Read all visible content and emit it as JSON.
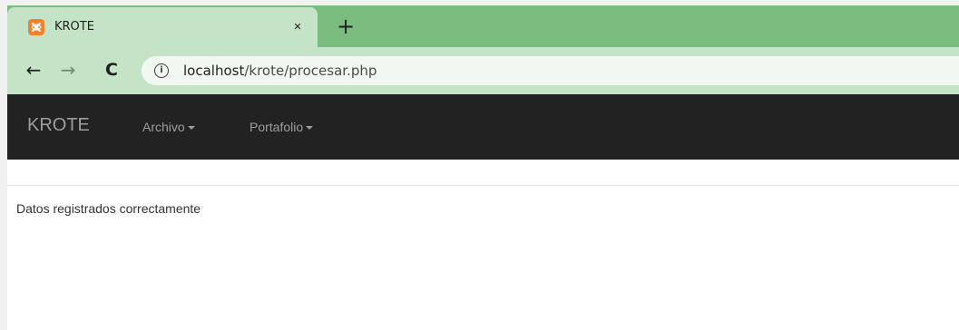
{
  "browser": {
    "tab": {
      "title": "KROTE",
      "favicon": "xampp-icon",
      "close_glyph": "×"
    },
    "new_tab_glyph": "+",
    "toolbar": {
      "back_glyph": "←",
      "forward_glyph": "→",
      "reload_glyph": "C"
    },
    "address": {
      "host": "localhost",
      "path": "/krote/procesar.php",
      "info_glyph": "i"
    },
    "colors": {
      "tabstrip": "#7bbd7e",
      "active_tab": "#c5e4c7"
    }
  },
  "navbar": {
    "brand": "KROTE",
    "items": [
      {
        "label": "Archivo"
      },
      {
        "label": "Portafolio"
      }
    ],
    "background": "#222222"
  },
  "main": {
    "message": "Datos registrados correctamente"
  }
}
